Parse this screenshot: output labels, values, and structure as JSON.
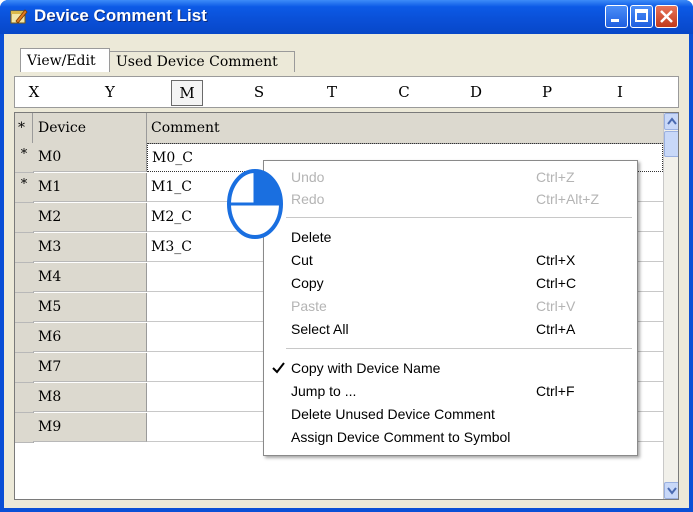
{
  "window": {
    "title": "Device Comment List"
  },
  "tabs": [
    {
      "label": "View/Edit"
    },
    {
      "label": "Used Device Comment"
    }
  ],
  "letters": [
    "X",
    "Y",
    "M",
    "S",
    "T",
    "C",
    "D",
    "P",
    "I"
  ],
  "selected_letter": "M",
  "grid": {
    "headers": {
      "mark": "*",
      "device": "Device",
      "comment": "Comment"
    },
    "rows": [
      {
        "mark": "*",
        "device": "M0",
        "comment": "M0_C"
      },
      {
        "mark": "*",
        "device": "M1",
        "comment": "M1_C"
      },
      {
        "mark": "",
        "device": "M2",
        "comment": "M2_C"
      },
      {
        "mark": "",
        "device": "M3",
        "comment": "M3_C"
      },
      {
        "mark": "",
        "device": "M4",
        "comment": ""
      },
      {
        "mark": "",
        "device": "M5",
        "comment": ""
      },
      {
        "mark": "",
        "device": "M6",
        "comment": ""
      },
      {
        "mark": "",
        "device": "M7",
        "comment": ""
      },
      {
        "mark": "",
        "device": "M8",
        "comment": ""
      },
      {
        "mark": "",
        "device": "M9",
        "comment": ""
      }
    ]
  },
  "context_menu": {
    "undo": {
      "label": "Undo",
      "shortcut": "Ctrl+Z"
    },
    "redo": {
      "label": "Redo",
      "shortcut": "Ctrl+Alt+Z"
    },
    "delete": {
      "label": "Delete"
    },
    "cut": {
      "label": "Cut",
      "shortcut": "Ctrl+X"
    },
    "copy": {
      "label": "Copy",
      "shortcut": "Ctrl+C"
    },
    "paste": {
      "label": "Paste",
      "shortcut": "Ctrl+V"
    },
    "select_all": {
      "label": "Select All",
      "shortcut": "Ctrl+A"
    },
    "copy_with_name": {
      "label": "Copy with Device Name",
      "checked": true
    },
    "jump_to": {
      "label": "Jump to ...",
      "shortcut": "Ctrl+F"
    },
    "delete_unused": {
      "label": "Delete Unused Device Comment"
    },
    "assign_symbol": {
      "label": "Assign Device Comment to Symbol"
    }
  },
  "colors": {
    "titlebar": "#0a4fd6",
    "grid_header": "#dcd9cf",
    "menu_disabled": "#b4b4b4"
  },
  "icons": [
    "edit-window-icon",
    "minimize-icon",
    "maximize-icon",
    "close-icon",
    "scroll-up-icon",
    "scroll-down-icon",
    "checkmark-icon",
    "mouse-right-click-icon"
  ]
}
